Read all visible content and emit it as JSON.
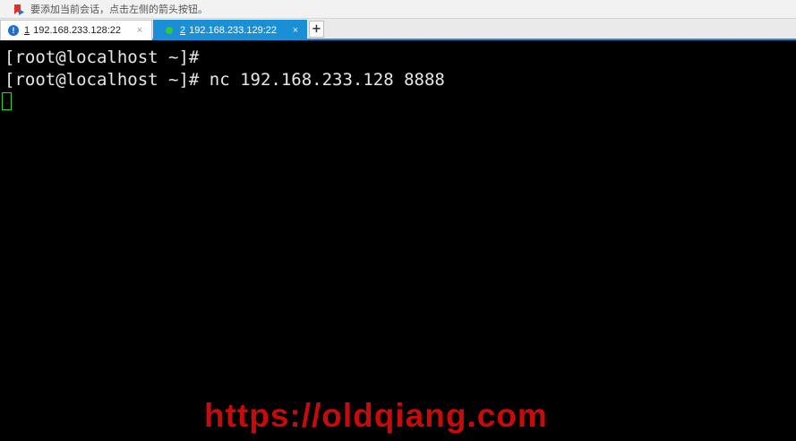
{
  "hint_bar": {
    "icon": "bookmark-flag-icon",
    "text": "要添加当前会话，点击左侧的箭头按钮。"
  },
  "tabs": [
    {
      "number": "1",
      "label": "192.168.233.128:22",
      "status_icon": "info-icon",
      "close": "×",
      "active": false
    },
    {
      "number": "2",
      "label": "192.168.233.129:22",
      "status_icon": "connected-dot-icon",
      "close": "×",
      "active": true
    }
  ],
  "new_tab": "+",
  "terminal": {
    "lines": [
      "[root@localhost ~]#",
      "[root@localhost ~]# nc 192.168.233.128 8888"
    ]
  },
  "watermark": "https://oldqiang.com",
  "colors": {
    "accent": "#1a8fd6",
    "terminal_bg": "#000000",
    "terminal_text": "#e6e6e6",
    "cursor": "#2fd42f",
    "watermark": "#c40c0c",
    "status_connected": "#35c93a",
    "status_info": "#1a73c9"
  }
}
